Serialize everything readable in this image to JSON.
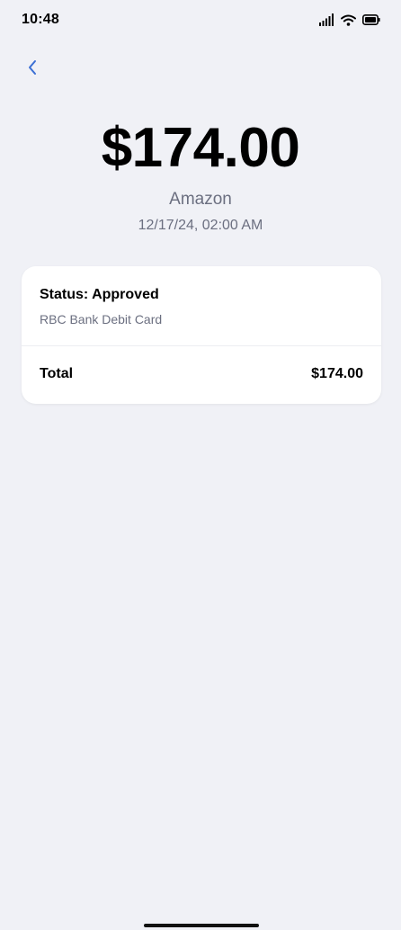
{
  "status_bar": {
    "time": "10:48",
    "icons": [
      "signal-icon",
      "wifi-icon",
      "battery-icon"
    ]
  },
  "nav": {
    "back_icon": "chevron-left-icon"
  },
  "transaction": {
    "amount": "$174.00",
    "merchant": "Amazon",
    "datetime": "12/17/24, 02:00 AM"
  },
  "details": {
    "status": "Status: Approved",
    "payment_method": "RBC Bank Debit Card",
    "total_label": "Total",
    "total_value": "$174.00"
  },
  "colors": {
    "background": "#f0f1f6",
    "accent": "#3b6fd4",
    "secondary_text": "#6b6f80"
  }
}
